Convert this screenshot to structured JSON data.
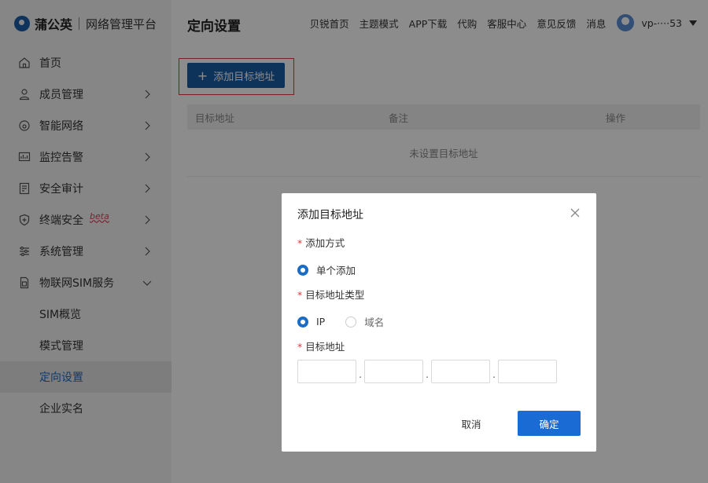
{
  "brand": {
    "name": "蒲公英",
    "subtitle": "网络管理平台"
  },
  "sidebar": {
    "items": [
      {
        "label": "首页",
        "icon": "home-icon"
      },
      {
        "label": "成员管理",
        "icon": "user-icon"
      },
      {
        "label": "智能网络",
        "icon": "network-icon"
      },
      {
        "label": "监控告警",
        "icon": "monitor-icon"
      },
      {
        "label": "安全审计",
        "icon": "audit-icon"
      },
      {
        "label": "终端安全",
        "icon": "shield-icon",
        "badge": "beta"
      },
      {
        "label": "系统管理",
        "icon": "settings-icon"
      },
      {
        "label": "物联网SIM服务",
        "icon": "sim-icon"
      }
    ],
    "sim_sub_items": [
      {
        "label": "SIM概览"
      },
      {
        "label": "模式管理"
      },
      {
        "label": "定向设置",
        "active": true
      },
      {
        "label": "企业实名"
      }
    ]
  },
  "header": {
    "page_title": "定向设置",
    "nav": [
      "贝锐首页",
      "主题模式",
      "APP下载",
      "代购",
      "客服中心",
      "意见反馈",
      "消息"
    ],
    "user_name": "vp-····53"
  },
  "main": {
    "add_button_label": "添加目标地址",
    "table": {
      "columns": [
        "目标地址",
        "备注",
        "操作"
      ],
      "empty_text": "未设置目标地址"
    }
  },
  "modal": {
    "title": "添加目标地址",
    "method_label": "添加方式",
    "method_option": "单个添加",
    "type_label": "目标地址类型",
    "type_options": [
      "IP",
      "域名"
    ],
    "address_label": "目标地址",
    "ip_segments": [
      "",
      "",
      "",
      ""
    ],
    "cancel_label": "取消",
    "confirm_label": "确定"
  },
  "colors": {
    "primary": "#1b5ea6",
    "active_text": "#1a6cc4",
    "required_mark": "#e0383e",
    "highlight_border": "#e0383e"
  }
}
